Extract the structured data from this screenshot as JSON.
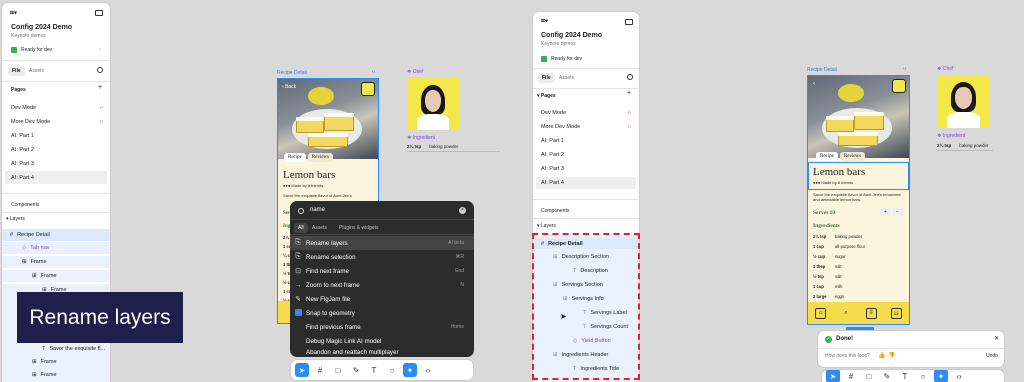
{
  "left_panel": {
    "project_name": "Config 2024 Demo",
    "project_sub": "Keynote demos",
    "ready": "Ready for dev",
    "tab_file": "File",
    "tab_assets": "Assets",
    "pages_label": "Pages",
    "pages": [
      "Dev Mode",
      "More Dev Mode",
      "AI: Part 1",
      "AI: Part 2",
      "AI: Part 3",
      "AI: Part 4"
    ],
    "components_label": "Components",
    "layers_label": "Layers",
    "layers": [
      "Recipe Detail",
      "Tab nav",
      "Frame",
      "Frame",
      "Frame"
    ],
    "layers_bottom": [
      "Savor the exquisite fl...",
      "Frame",
      "Frame"
    ]
  },
  "caption": "Rename layers",
  "canvas1": {
    "recipe_label": "Recipe Detail",
    "chef_label": "Chef",
    "ingredient_label": "Ingredient",
    "ing_qty": "2¼ tsp",
    "ing_name": "baking powder",
    "back": "Back",
    "tab_recipe": "Recipe",
    "tab_reviews": "Reviews",
    "title": "Lemon bars",
    "made_by": "Made by 8 friends",
    "desc": "Savor the exquisite flavor of Aunt Jen's",
    "serves": "Serves",
    "ingr": "Ingr",
    "rows": [
      "2¼",
      "1 cu",
      "¼ cu",
      "1 tb",
      "½ tsp",
      "½ cu",
      "1 cu",
      "½ cu"
    ]
  },
  "quick_actions": {
    "query": "name",
    "tabs": [
      "All",
      "Assets",
      "Plugins & widgets"
    ],
    "items": [
      {
        "label": "Rename layers",
        "shortcut": "AI beta",
        "icon": "rename-icon"
      },
      {
        "label": "Rename selection",
        "shortcut": "⌘R",
        "icon": "rename-icon"
      },
      {
        "label": "Find next frame",
        "shortcut": "End",
        "icon": "find-icon"
      },
      {
        "label": "Zoom to next frame",
        "shortcut": "N",
        "icon": "zoom-icon"
      },
      {
        "label": "New FigJam file",
        "shortcut": "",
        "icon": "figjam-icon"
      },
      {
        "label": "Snap to geometry",
        "shortcut": "",
        "icon": "checkbox-icon"
      },
      {
        "label": "Find previous frame",
        "shortcut": "Home",
        "icon": ""
      },
      {
        "label": "Debug Magic Link AI model",
        "shortcut": "",
        "icon": ""
      },
      {
        "label": "Abandon and reattach multiplayer",
        "shortcut": "",
        "icon": ""
      }
    ]
  },
  "middle_panel": {
    "project_name": "Config 2024 Demo",
    "project_sub": "Keynote demos",
    "ready": "Ready for dev",
    "tab_file": "File",
    "tab_assets": "Assets",
    "pages_label": "Pages",
    "pages": [
      "Dev Mode",
      "More Dev Mode",
      "AI: Part 1",
      "AI: Part 2",
      "AI: Part 3",
      "AI: Part 4"
    ],
    "components_label": "Components",
    "layers_label": "Layers",
    "layers": [
      {
        "label": "Recipe Detail",
        "indent": 0
      },
      {
        "label": "Description Section",
        "indent": 1
      },
      {
        "label": "Description",
        "indent": 2
      },
      {
        "label": "Servings Section",
        "indent": 1
      },
      {
        "label": "Servings Info",
        "indent": 2
      },
      {
        "label": "Servings Label",
        "indent": 3
      },
      {
        "label": "Servings Count",
        "indent": 3
      },
      {
        "label": "Yield Button",
        "indent": 2
      },
      {
        "label": "Ingredients Header",
        "indent": 1
      },
      {
        "label": "Ingredients Title",
        "indent": 2
      }
    ]
  },
  "canvas2": {
    "recipe_label": "Recipe Detail",
    "chef_label": "Chef",
    "ingredient_label": "Ingredient",
    "ing_qty": "2¼ tsp",
    "ing_name": "baking powder",
    "tab_recipe": "Recipe",
    "tab_reviews": "Reviews",
    "title": "Lemon bars",
    "made_by": "Made by 8 friends",
    "desc": "Savor the exquisite flavor of Aunt Jen's renowned and delectable lemon bars.",
    "serves": "Serves 10",
    "ingredients_title": "Ingredients",
    "ingredients": [
      {
        "q": "2¼ tsp",
        "n": "baking powder"
      },
      {
        "q": "1 cup",
        "n": "all-purpose flour"
      },
      {
        "q": "⅓ cup",
        "n": "sugar"
      },
      {
        "q": "1 tbsp",
        "n": "salt"
      },
      {
        "q": "½ tsp",
        "n": "salt"
      },
      {
        "q": "1 cup",
        "n": "milk"
      },
      {
        "q": "2 large",
        "n": "eggs"
      },
      {
        "q": "¼ cup",
        "n": "vegetable oil"
      }
    ]
  },
  "toast": {
    "title": "Done!",
    "question": "How does this look?",
    "undo": "Undo"
  },
  "colors": {
    "accent": "#2a8cf5",
    "purple": "#8a3ff5",
    "dash": "#e02424",
    "nav": "#f6dc4c"
  }
}
